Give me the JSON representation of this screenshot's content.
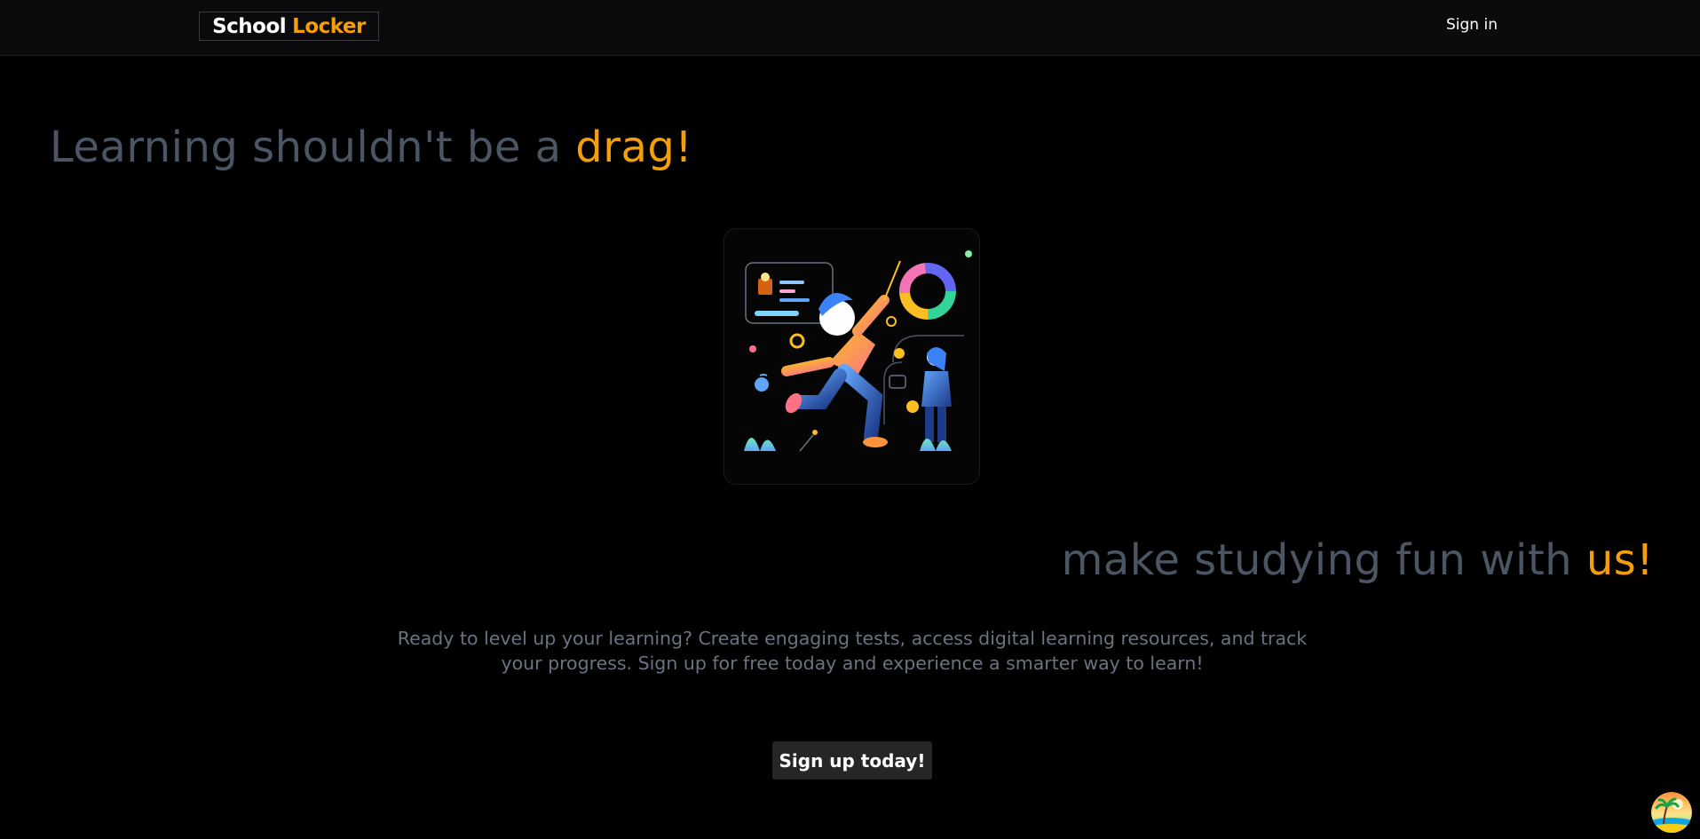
{
  "nav": {
    "logo_part1": "School",
    "logo_part2": "Locker",
    "signin_label": "Sign in"
  },
  "hero": {
    "title_main": "Learning shouldn't be a",
    "title_accent": "drag!",
    "illustration_icon": "student-learning-illustration-icon"
  },
  "tagline": {
    "main": "make studying fun with",
    "accent": "us!"
  },
  "description": "Ready to level up your learning? Create engaging tests, access digital learning resources, and track your progress. Sign up for free today and experience a smarter way to learn!",
  "cta": {
    "label": "Sign up today!"
  },
  "colors": {
    "accent": "#f59e0b",
    "muted_heading": "#4b5563",
    "body_text": "#6b7280",
    "navbar_bg": "#0b0b0d",
    "button_bg": "#262626"
  }
}
